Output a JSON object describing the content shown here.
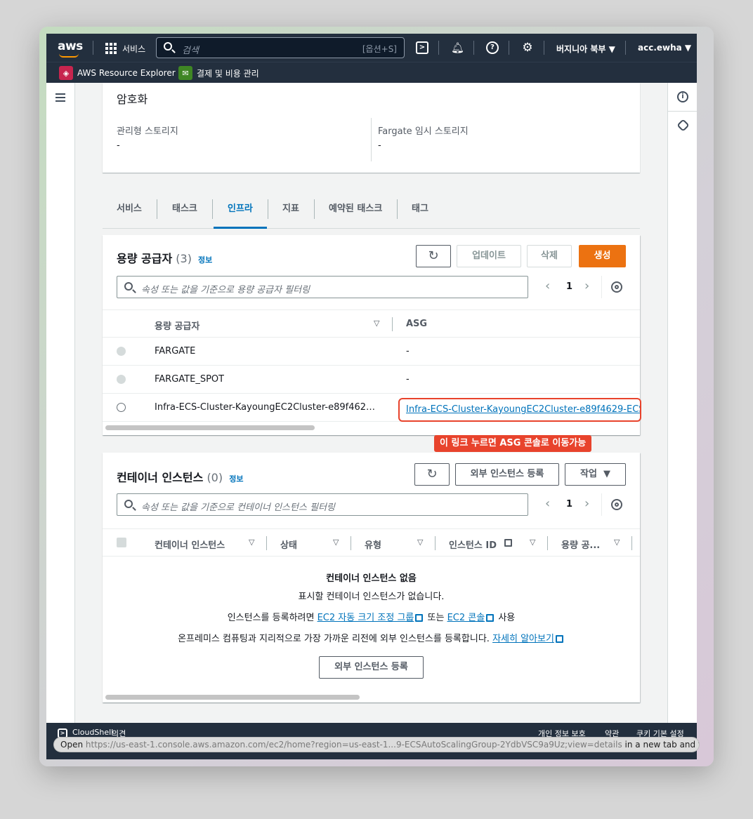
{
  "nav": {
    "logo": "aws",
    "services_label": "서비스",
    "search_placeholder": "검색",
    "search_shortcut": "[옵션+S]",
    "region": "버지니아 북부 ▼",
    "account": "acc.ewha ▼",
    "icons": [
      "cloudshell-icon",
      "bell-icon",
      "help-icon",
      "settings-icon"
    ]
  },
  "favorites": [
    {
      "label": "AWS Resource Explorer",
      "icon": "resource-explorer-icon",
      "color": "#c7254e"
    },
    {
      "label": "결제 및 비용 관리",
      "icon": "billing-icon",
      "color": "#3f8624"
    }
  ],
  "encryption": {
    "title": "암호화",
    "managed_storage_label": "관리형 스토리지",
    "managed_storage_value": "-",
    "fargate_label": "Fargate 임시 스토리지",
    "fargate_value": "-"
  },
  "tabs": [
    {
      "label": "서비스",
      "active": false
    },
    {
      "label": "태스크",
      "active": false
    },
    {
      "label": "인프라",
      "active": true
    },
    {
      "label": "지표",
      "active": false
    },
    {
      "label": "예약된 태스크",
      "active": false
    },
    {
      "label": "태그",
      "active": false
    }
  ],
  "capacity": {
    "title": "용량 공급자",
    "count": "(3)",
    "info": "정보",
    "update_label": "업데이트",
    "delete_label": "삭제",
    "create_label": "생성",
    "filter_placeholder": "속성 또는 값을 기준으로 용량 공급자 필터링",
    "page": "1",
    "col_provider": "용량 공급자",
    "col_asg": "ASG",
    "rows": [
      {
        "provider": "FARGATE",
        "asg": "-"
      },
      {
        "provider": "FARGATE_SPOT",
        "asg": "-"
      },
      {
        "provider": "Infra-ECS-Cluster-KayoungEC2Cluster-e89f462…",
        "asg": "Infra-ECS-Cluster-KayoungEC2Cluster-e89f4629-ECS"
      }
    ],
    "callout": "이 링크 누르면 ASG 콘솔로 이동가능"
  },
  "instances": {
    "title": "컨테이너 인스턴스",
    "count": "(0)",
    "info": "정보",
    "register_label": "외부 인스턴스 등록",
    "actions_label": "작업",
    "filter_placeholder": "속성 또는 값을 기준으로 컨테이너 인스턴스 필터링",
    "page": "1",
    "columns": [
      "컨테이너 인스턴스",
      "상태",
      "유형",
      "인스턴스 ID",
      "용량 공..."
    ],
    "empty_title": "컨테이너 인스턴스 없음",
    "empty_desc": "표시할 컨테이너 인스턴스가 없습니다.",
    "empty_line2_prefix": "인스턴스를 등록하려면",
    "empty_line2_link1": "EC2 자동 크기 조정 그룹",
    "empty_line2_mid": "또는",
    "empty_line2_link2": "EC2 콘솔",
    "empty_line2_suffix": "사용",
    "empty_line3_prefix": "온프레미스 컴퓨팅과 지리적으로 가장 가까운 리전에 외부 인스턴스를 등록합니다.",
    "empty_line3_link": "자세히 알아보기",
    "empty_button": "외부 인스턴스 등록"
  },
  "footer": {
    "cloudshell": "CloudShell",
    "feedback": "의견",
    "privacy": "개인 정보 보호",
    "terms": "약관",
    "cookies": "쿠키 기본 설정"
  },
  "status_bar": {
    "prefix": "Open",
    "url": "https://us-east-1.console.aws.amazon.com/ec2/home?region=us-east-1...9-ECSAutoScalingGroup-2YdbVSC9a9Uz;view=details",
    "suffix": "in a new tab and focus it"
  }
}
